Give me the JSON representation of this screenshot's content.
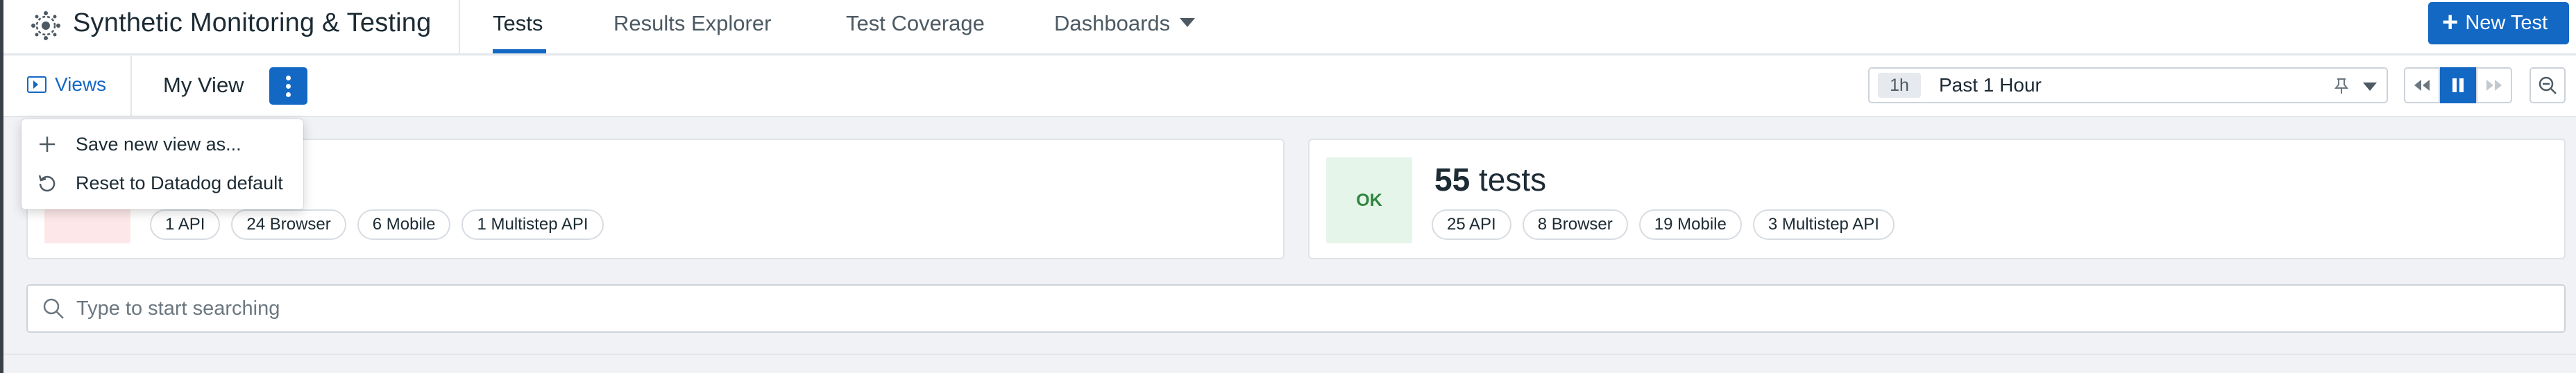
{
  "app": {
    "title": "Synthetic Monitoring & Testing"
  },
  "nav": {
    "tabs": [
      {
        "label": "Tests",
        "active": true
      },
      {
        "label": "Results Explorer",
        "active": false
      },
      {
        "label": "Test Coverage",
        "active": false
      },
      {
        "label": "Dashboards",
        "active": false
      }
    ],
    "new_test_label": "New Test"
  },
  "subbar": {
    "views_label": "Views",
    "current_view": "My View",
    "time_badge": "1h",
    "time_range": "Past 1 Hour"
  },
  "menu": {
    "items": [
      {
        "label": "Save new view as...",
        "icon": "plus-icon"
      },
      {
        "label": "Reset to Datadog default",
        "icon": "reset-icon"
      }
    ]
  },
  "cards": {
    "alert": {
      "status": "",
      "pills": [
        "1 API",
        "24 Browser",
        "6 Mobile",
        "1 Multistep API"
      ]
    },
    "ok": {
      "status": "OK",
      "count": "55",
      "count_suffix": "tests",
      "pills": [
        "25 API",
        "8 Browser",
        "19 Mobile",
        "3 Multistep API"
      ]
    }
  },
  "search": {
    "placeholder": "Type to start searching",
    "value": ""
  },
  "colors": {
    "accent": "#1368c4",
    "alert_bg": "#fde7e8",
    "ok_bg": "#e6f5e9",
    "ok_text": "#2e8540"
  }
}
